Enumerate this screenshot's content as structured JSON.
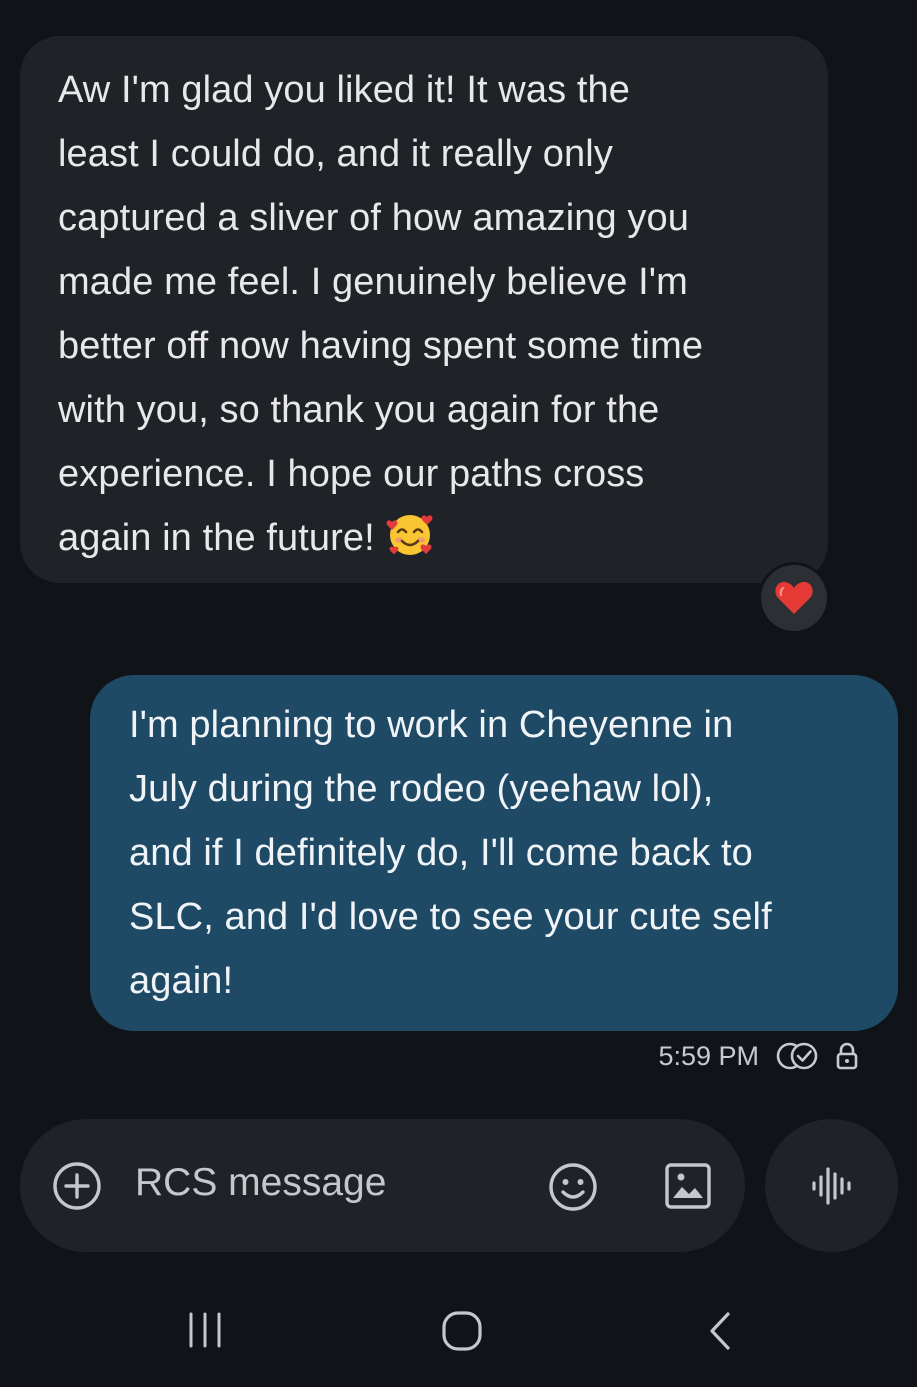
{
  "incoming_message": {
    "lines": [
      "Aw I'm glad you liked it! It was the",
      "least I could do, and it really only",
      "captured a sliver of how amazing you",
      "made me feel. I genuinely believe I'm",
      "better off now having spent some time",
      "with you, so thank you again for the",
      "experience. I hope our paths cross",
      "again in the future!"
    ],
    "trailing_emoji": "smiling-face-with-hearts-icon",
    "reaction": "red-heart-icon"
  },
  "outgoing_message": {
    "lines": [
      "I'm planning to work in Cheyenne in",
      "July during the rodeo (yeehaw lol),",
      "and if I definitely do, I'll come back to",
      "SLC, and I'd love to see your cute self",
      "again!"
    ],
    "timestamp": "5:59 PM",
    "status_icon": "read-receipt-icon",
    "encryption_icon": "lock-icon"
  },
  "composer": {
    "placeholder": "RCS message",
    "add_icon": "plus-circle-icon",
    "emoji_icon": "emoji-icon",
    "gallery_icon": "image-icon",
    "voice_icon": "voice-waveform-icon"
  },
  "navigation": {
    "recents_icon": "recents-icon",
    "home_icon": "home-icon",
    "back_icon": "back-icon"
  },
  "colors": {
    "background": "#101318",
    "incoming_bubble": "#1f2226",
    "outgoing_bubble": "#1e4a66",
    "reaction_heart": "#e53935"
  }
}
